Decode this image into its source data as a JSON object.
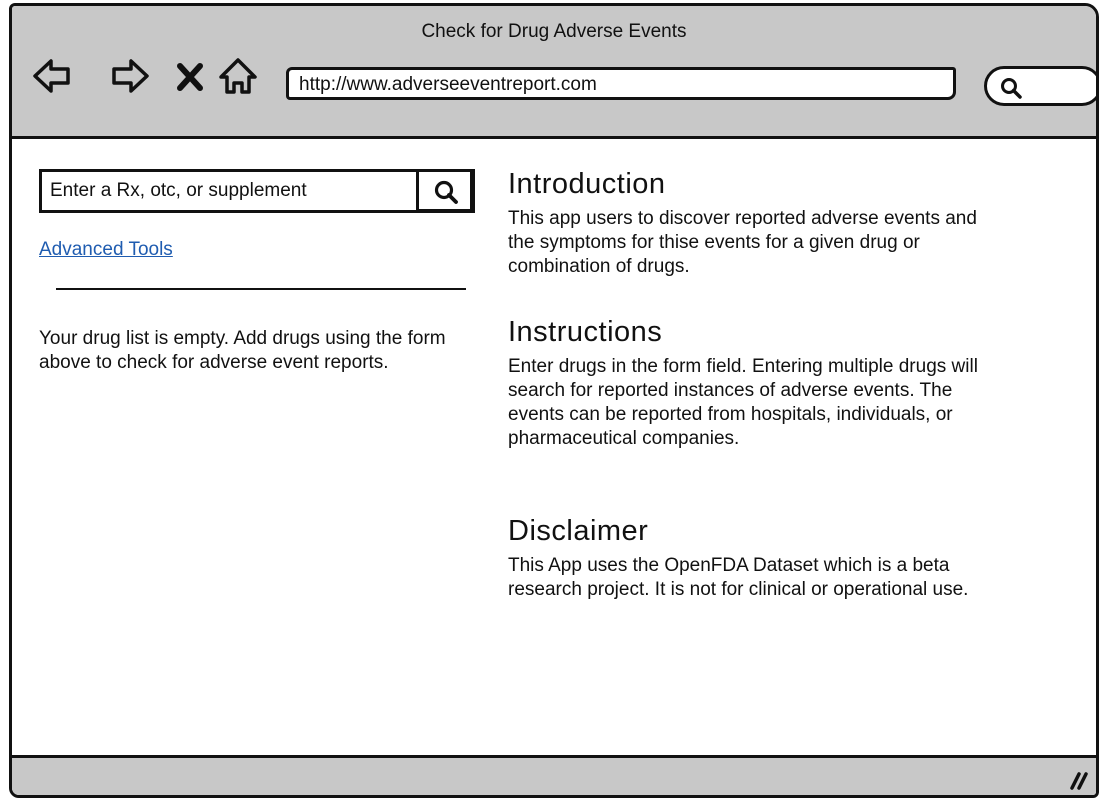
{
  "window": {
    "title": "Check for Drug Adverse Events"
  },
  "toolbar": {
    "back_icon": "arrow-left-icon",
    "forward_icon": "arrow-right-icon",
    "stop_icon": "close-icon",
    "home_icon": "home-icon",
    "url": "http://www.adverseeventreport.com",
    "search_icon": "search-icon"
  },
  "sidebar": {
    "search_placeholder": "Enter a Rx, otc, or supplement",
    "advanced_link": "Advanced Tools",
    "empty_message": "Your drug list is empty. Add drugs using the form above to check for adverse event reports."
  },
  "main": {
    "introduction": {
      "heading": "Introduction",
      "body": "This app users to discover reported adverse events and the symptoms for thise events for a given drug or combination of drugs."
    },
    "instructions": {
      "heading": "Instructions",
      "body": "Enter drugs in the form field. Entering multiple drugs will search for reported instances of adverse events. The events can be reported from hospitals, individuals, or pharmaceutical companies."
    },
    "disclaimer": {
      "heading": "Disclaimer",
      "body": "This App uses the OpenFDA Dataset which is a beta research project. It is not for clinical or operational use."
    }
  },
  "colors": {
    "chrome": "#c8c8c8",
    "link": "#1f5cb0",
    "ink": "#111111"
  }
}
